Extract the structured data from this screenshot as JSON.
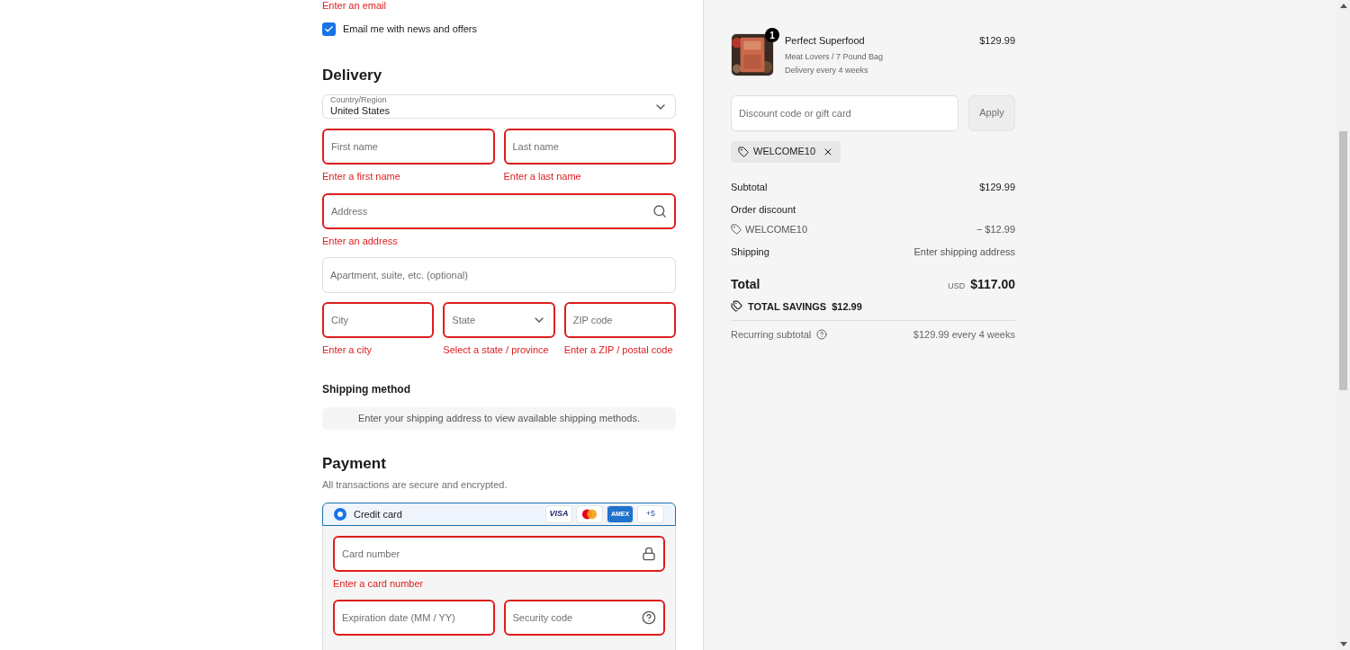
{
  "contact": {
    "error": "Enter an email",
    "newsletter": {
      "label": "Email me with news and offers",
      "checked": true
    }
  },
  "delivery": {
    "heading": "Delivery",
    "country": {
      "label": "Country/Region",
      "value": "United States"
    },
    "rows": [
      [
        {
          "kind": "text",
          "placeholder": "First name",
          "invalid": true,
          "error": "Enter a first name"
        },
        {
          "kind": "text",
          "placeholder": "Last name",
          "invalid": true,
          "error": "Enter a last name"
        }
      ],
      [
        {
          "kind": "search",
          "placeholder": "Address",
          "invalid": true,
          "error": "Enter an address"
        }
      ],
      [
        {
          "kind": "text",
          "placeholder": "Apartment, suite, etc. (optional)",
          "invalid": false
        }
      ],
      [
        {
          "kind": "text",
          "placeholder": "City",
          "invalid": true,
          "error": "Enter a city"
        },
        {
          "kind": "select",
          "placeholder": "State",
          "invalid": true,
          "error": "Select a state / province"
        },
        {
          "kind": "text",
          "placeholder": "ZIP code",
          "invalid": true,
          "error": "Enter a ZIP / postal code"
        }
      ]
    ]
  },
  "shipping_method": {
    "heading": "Shipping method",
    "notice": "Enter your shipping address to view available shipping methods."
  },
  "payment": {
    "heading": "Payment",
    "subtitle": "All transactions are secure and encrypted.",
    "methods": [
      {
        "label": "Credit card",
        "selected": true,
        "brands": [
          {
            "kind": "visa",
            "text": "VISA"
          },
          {
            "kind": "mastercard"
          },
          {
            "kind": "amex",
            "text": "AMEX"
          },
          {
            "kind": "more",
            "text": "+5"
          }
        ]
      }
    ],
    "card_rows": [
      [
        {
          "kind": "lock",
          "placeholder": "Card number",
          "invalid": true,
          "error": "Enter a card number"
        }
      ],
      [
        {
          "kind": "text",
          "placeholder": "Expiration date (MM / YY)",
          "invalid": true
        },
        {
          "kind": "help",
          "placeholder": "Security code",
          "invalid": true
        }
      ]
    ]
  },
  "summary": {
    "item": {
      "quantity": "1",
      "name": "Perfect Superfood",
      "variant": "Meat Lovers / 7 Pound Bag",
      "plan": "Delivery every 4 weeks",
      "price": "$129.99"
    },
    "discount": {
      "placeholder": "Discount code or gift card",
      "button": "Apply",
      "disabled": true
    },
    "applied_codes": [
      "WELCOME10"
    ],
    "lines": [
      {
        "kind": "plain",
        "label": "Subtotal",
        "value": "$129.99"
      },
      {
        "kind": "heading",
        "label": "Order discount"
      },
      {
        "kind": "code",
        "label": "WELCOME10",
        "value": "− $12.99"
      },
      {
        "kind": "muted_value",
        "label": "Shipping",
        "value": "Enter shipping address"
      }
    ],
    "total": {
      "label": "Total",
      "currency": "USD",
      "amount": "$117.00"
    },
    "savings": {
      "label": "TOTAL SAVINGS",
      "amount": "$12.99"
    },
    "recurring": {
      "label": "Recurring subtotal",
      "value": "$129.99 every 4 weeks"
    }
  }
}
